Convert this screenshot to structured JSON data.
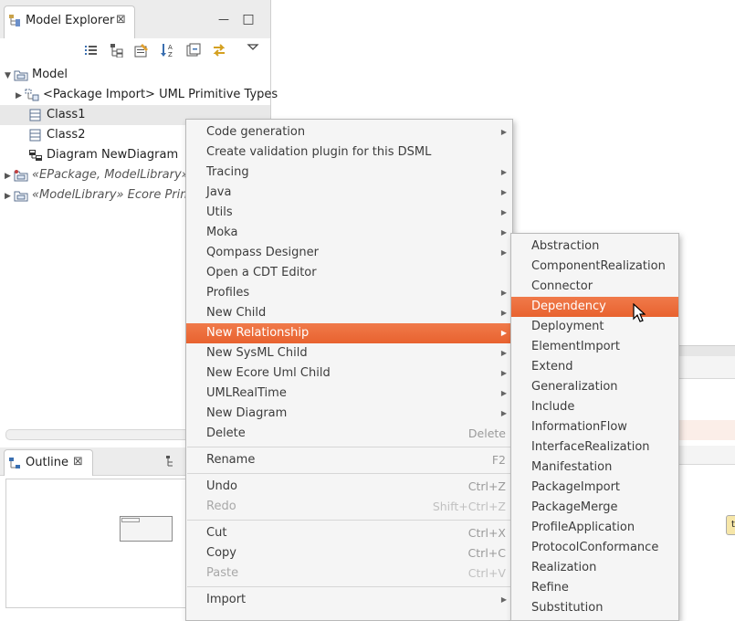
{
  "explorer": {
    "tab_label": "Model Explorer",
    "close_glyph": "⊠",
    "minimize_glyph": "—",
    "maximize_glyph": "□",
    "toolbar_icons": [
      "list-icon",
      "tree-icon",
      "edit-icon",
      "sort-az-icon",
      "collapse-icon",
      "link-icon",
      "view-menu-icon"
    ],
    "tree": [
      {
        "label": "Model",
        "level": 0,
        "expanded": true,
        "icon": "package-icon"
      },
      {
        "label": "<Package Import> UML Primitive Types",
        "level": 1,
        "expanded": false,
        "icon": "package-import-icon"
      },
      {
        "label": "Class1",
        "level": 1,
        "icon": "class-icon",
        "selected": true
      },
      {
        "label": "Class2",
        "level": 1,
        "icon": "class-icon"
      },
      {
        "label": "Diagram NewDiagram",
        "level": 1,
        "icon": "diagram-icon"
      },
      {
        "label": "«EPackage, ModelLibrary» U",
        "level": 0,
        "expanded": false,
        "icon": "epackage-icon",
        "italic": true
      },
      {
        "label": "«ModelLibrary» Ecore Primiti",
        "level": 0,
        "expanded": false,
        "icon": "library-icon",
        "italic": true
      }
    ]
  },
  "outline": {
    "tab_label": "Outline",
    "close_glyph": "⊠"
  },
  "context_menu": {
    "items": [
      {
        "label": "Code generation",
        "submenu": true
      },
      {
        "label": "Create validation plugin for this DSML"
      },
      {
        "label": "Tracing",
        "submenu": true
      },
      {
        "label": "Java",
        "submenu": true
      },
      {
        "label": "Utils",
        "submenu": true
      },
      {
        "label": "Moka",
        "submenu": true
      },
      {
        "label": "Qompass Designer",
        "submenu": true
      },
      {
        "label": "Open a CDT Editor"
      },
      {
        "label": "Profiles",
        "submenu": true
      },
      {
        "label": "New Child",
        "submenu": true
      },
      {
        "label": "New Relationship",
        "submenu": true,
        "highlighted": true
      },
      {
        "label": "New SysML Child",
        "submenu": true
      },
      {
        "label": "New Ecore Uml Child",
        "submenu": true
      },
      {
        "label": "UMLRealTime",
        "submenu": true
      },
      {
        "label": "New Diagram",
        "submenu": true
      },
      {
        "label": "Delete",
        "accelerator": "Delete"
      },
      {
        "separator": true
      },
      {
        "label": "Rename",
        "accelerator": "F2"
      },
      {
        "separator": true
      },
      {
        "label": "Undo",
        "accelerator": "Ctrl+Z"
      },
      {
        "label": "Redo",
        "accelerator": "Shift+Ctrl+Z",
        "disabled": true
      },
      {
        "separator": true
      },
      {
        "label": "Cut",
        "accelerator": "Ctrl+X"
      },
      {
        "label": "Copy",
        "accelerator": "Ctrl+C"
      },
      {
        "label": "Paste",
        "accelerator": "Ctrl+V",
        "disabled": true
      },
      {
        "separator": true
      },
      {
        "label": "Import",
        "submenu": true
      }
    ]
  },
  "submenu": {
    "items": [
      {
        "label": "Abstraction"
      },
      {
        "label": "ComponentRealization"
      },
      {
        "label": "Connector"
      },
      {
        "label": "Dependency",
        "highlighted": true
      },
      {
        "label": "Deployment"
      },
      {
        "label": "ElementImport"
      },
      {
        "label": "Extend"
      },
      {
        "label": "Generalization"
      },
      {
        "label": "Include"
      },
      {
        "label": "InformationFlow"
      },
      {
        "label": "InterfaceRealization"
      },
      {
        "label": "Manifestation"
      },
      {
        "label": "PackageImport"
      },
      {
        "label": "PackageMerge"
      },
      {
        "label": "ProfileApplication"
      },
      {
        "label": "ProtocolConformance"
      },
      {
        "label": "Realization"
      },
      {
        "label": "Refine"
      },
      {
        "label": "Substitution"
      }
    ]
  },
  "colors": {
    "highlight": "#e8622f",
    "menu_bg": "#f5f5f5"
  }
}
